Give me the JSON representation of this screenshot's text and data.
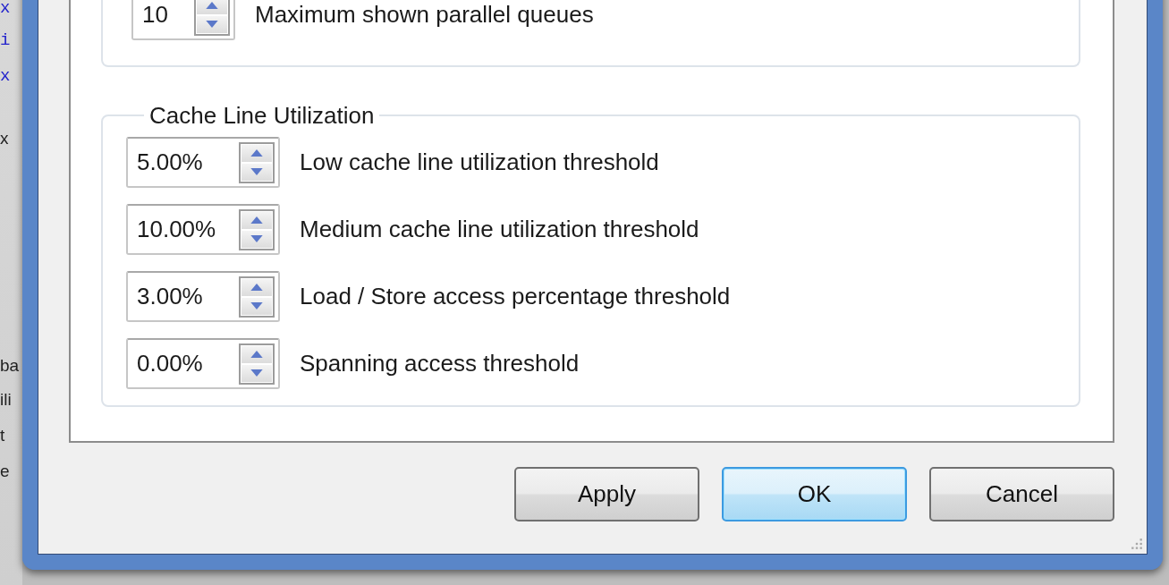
{
  "background_fragments": [
    "x",
    "i",
    "x",
    "x",
    "ba",
    "ili",
    "t",
    "e"
  ],
  "queues_group": {
    "field": {
      "value": "10",
      "label": "Maximum shown parallel queues"
    }
  },
  "cache_group": {
    "title": "Cache Line Utilization",
    "fields": [
      {
        "value": "5.00%",
        "label": "Low cache line utilization threshold"
      },
      {
        "value": "10.00%",
        "label": "Medium cache line utilization threshold"
      },
      {
        "value": "3.00%",
        "label": "Load / Store access percentage threshold"
      },
      {
        "value": "0.00%",
        "label": "Spanning access threshold"
      }
    ]
  },
  "buttons": [
    {
      "label": "Apply",
      "default": false
    },
    {
      "label": "OK",
      "default": true
    },
    {
      "label": "Cancel",
      "default": false
    }
  ]
}
